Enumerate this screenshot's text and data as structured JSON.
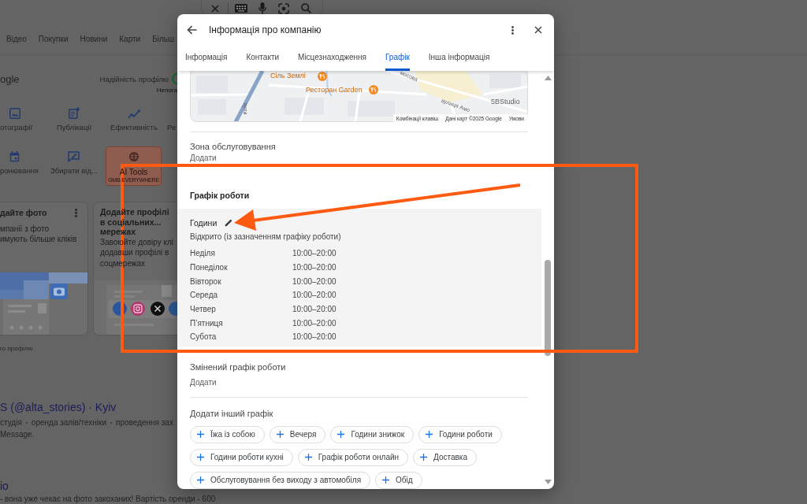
{
  "page": {
    "nav_tabs": [
      "Відео",
      "Покупки",
      "Новини",
      "Карти",
      "Більш"
    ],
    "profile": {
      "title": "ogle",
      "strength_label": "Надійність профілю",
      "strength_value": "Непога",
      "action_rows": [
        [
          {
            "kind": "photos",
            "label": "отографії"
          },
          {
            "kind": "posts",
            "label": "Публікації"
          },
          {
            "kind": "performance",
            "label": "Ефективність"
          },
          {
            "kind": "label",
            "label": "Ре"
          }
        ],
        [
          {
            "kind": "bookings",
            "label": "ронювання"
          },
          {
            "kind": "reviews",
            "label": "Збирати від..."
          },
          {
            "kind": "promo",
            "label": "AI Tools",
            "sublabel": "GMB EVERYWHERE"
          }
        ]
      ],
      "cards": [
        {
          "kind": "photo",
          "title": "дайте фото",
          "lines": [
            "мпанії з фото",
            "имують більше кліків"
          ]
        },
        {
          "kind": "social",
          "title": "Додайте профілі в соціальних... мережах",
          "lines": [
            "Завоюйте довіру клі",
            "додавши профілі в",
            "соцмережах"
          ]
        }
      ],
      "footnote": "го профілю"
    },
    "results": [
      {
        "title": "S (@alta_stories) · Kyiv",
        "tags": [
          "студія",
          "оренда залів/техніки",
          "проведення зах"
        ],
        "snippet": "Message."
      },
      {
        "title": "io",
        "snippet": "- вона уже чекає на фото закоханих! Вартість оренди - 600"
      }
    ]
  },
  "dialog": {
    "title": "Інформація про компанію",
    "tabs": [
      {
        "label": "Інформація",
        "selected": false
      },
      {
        "label": "Контакти",
        "selected": false
      },
      {
        "label": "Місцезнаходження",
        "selected": false
      },
      {
        "label": "Графік",
        "selected": true
      },
      {
        "label": "Інша інформація",
        "selected": false
      }
    ],
    "map": {
      "places": [
        {
          "kind": "restaurant",
          "label": "Сіль Землі"
        },
        {
          "kind": "restaurant",
          "label": "Ресторан Garden"
        },
        {
          "kind": "business",
          "label": "5BStudio"
        }
      ],
      "streets": [
        "мосова",
        "вулиця Амо",
        "вули"
      ],
      "footer": [
        "Комбінації клавіш",
        "Дані карт ©2025 Google",
        "Умови"
      ]
    },
    "service_area": {
      "title": "Зона обслуговування",
      "action": "Додати"
    },
    "hours_section": {
      "title": "Графік роботи",
      "hours": {
        "title": "Години",
        "status": "Відкрито (із зазначенням графіку роботи)",
        "days": [
          {
            "day": "Неділя",
            "time": "10:00–20:00"
          },
          {
            "day": "Понеділок",
            "time": "10:00–20:00"
          },
          {
            "day": "Вівторок",
            "time": "10:00–20:00"
          },
          {
            "day": "Середа",
            "time": "10:00–20:00"
          },
          {
            "day": "Четвер",
            "time": "10:00–20:00"
          },
          {
            "day": "П’ятниця",
            "time": "10:00–20:00"
          },
          {
            "day": "Субота",
            "time": "10:00–20:00"
          }
        ]
      }
    },
    "special_hours": {
      "title": "Змінений графік роботи",
      "action": "Додати"
    },
    "more_hours": {
      "title": "Додати інший графік",
      "chips": [
        "Їжа із собою",
        "Вечеря",
        "Години знижок",
        "Години роботи",
        "Години роботи кухні",
        "Графік роботи онлайн",
        "Доставка",
        "Обслуговування без виходу з автомобіля",
        "Обід"
      ]
    }
  }
}
